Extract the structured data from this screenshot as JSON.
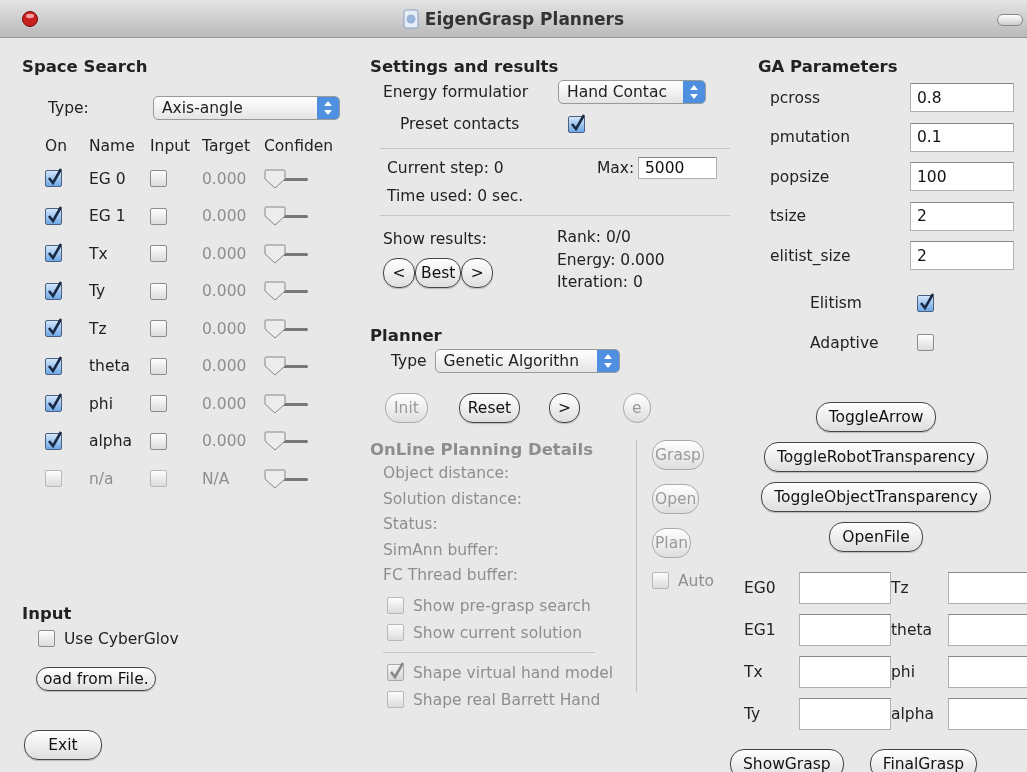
{
  "window": {
    "title": "EigenGrasp Planners"
  },
  "space_search": {
    "title": "Space Search",
    "type_label": "Type:",
    "type_value": "Axis-angle",
    "columns": [
      "On",
      "Name",
      "Input",
      "Target",
      "Confiden"
    ],
    "rows": [
      {
        "on": true,
        "name": "EG 0",
        "input": false,
        "target": "0.000",
        "level": 0,
        "disabled": false
      },
      {
        "on": true,
        "name": "EG 1",
        "input": false,
        "target": "0.000",
        "level": 0,
        "disabled": false
      },
      {
        "on": true,
        "name": "Tx",
        "input": false,
        "target": "0.000",
        "level": 0,
        "disabled": false
      },
      {
        "on": true,
        "name": "Ty",
        "input": false,
        "target": "0.000",
        "level": 0,
        "disabled": false
      },
      {
        "on": true,
        "name": "Tz",
        "input": false,
        "target": "0.000",
        "level": 0,
        "disabled": false
      },
      {
        "on": true,
        "name": "theta",
        "input": false,
        "target": "0.000",
        "level": 0,
        "disabled": false
      },
      {
        "on": true,
        "name": "phi",
        "input": false,
        "target": "0.000",
        "level": 0,
        "disabled": false
      },
      {
        "on": true,
        "name": "alpha",
        "input": false,
        "target": "0.000",
        "level": 0,
        "disabled": false
      },
      {
        "on": false,
        "name": "n/a",
        "input": false,
        "target": "N/A",
        "level": 0,
        "disabled": true
      }
    ]
  },
  "input": {
    "title": "Input",
    "use_cyberglove": {
      "label": "Use CyberGlov",
      "checked": false
    },
    "load_button": "oad from File.",
    "exit_button": "Exit"
  },
  "settings": {
    "title": "Settings and results",
    "energy_label": "Energy formulatior",
    "energy_value": "Hand Contac",
    "preset_label": "Preset contacts",
    "preset_checked": true,
    "current_step": "Current step: 0",
    "max_label": "Max:",
    "max_value": "5000",
    "time_used": "Time used: 0 sec.",
    "show_results": "Show results:",
    "result_buttons": [
      "<",
      "Best",
      ">"
    ],
    "rank": "Rank: 0/0",
    "energy": "Energy: 0.000",
    "iteration": "Iteration: 0"
  },
  "planner": {
    "title": "Planner",
    "type_label": "Type",
    "type_value": "Genetic Algorithn",
    "buttons": [
      {
        "label": "Init",
        "disabled": true
      },
      {
        "label": "Reset",
        "disabled": false
      },
      {
        "label": ">",
        "disabled": false
      },
      {
        "label": "e",
        "disabled": true
      }
    ]
  },
  "online": {
    "title": "OnLine Planning Details",
    "disabled": true,
    "fields": [
      "Object distance:",
      "Solution distance:",
      "Status:",
      "SimAnn buffer:",
      "FC Thread buffer:"
    ],
    "show_checks": [
      {
        "label": "Show pre-grasp search",
        "checked": false
      },
      {
        "label": "Show current solution",
        "checked": false
      }
    ],
    "hand_checks": [
      {
        "label": "Shape virtual hand model",
        "checked": true
      },
      {
        "label": "Shape real Barrett Hand",
        "checked": false
      }
    ],
    "buttons": [
      "Grasp",
      "Open",
      "Plan"
    ],
    "auto": {
      "label": "Auto",
      "checked": false
    }
  },
  "ga": {
    "title": "GA Parameters",
    "params": [
      {
        "label": "pcross",
        "value": "0.8"
      },
      {
        "label": "pmutation",
        "value": "0.1"
      },
      {
        "label": "popsize",
        "value": "100"
      },
      {
        "label": "tsize",
        "value": "2"
      },
      {
        "label": "elitist_size",
        "value": "2"
      }
    ],
    "checks": [
      {
        "label": "Elitism",
        "checked": true
      },
      {
        "label": "Adaptive",
        "checked": false
      }
    ],
    "buttons": [
      "ToggleArrow",
      "ToggleRobotTransparency",
      "ToggleObjectTransparency",
      "OpenFile"
    ],
    "dof_fields": [
      "EG0",
      "Tz",
      "EG1",
      "theta",
      "Tx",
      "phi",
      "Ty",
      "alpha"
    ],
    "bottom_buttons": [
      "ShowGrasp",
      "FinalGrasp"
    ]
  }
}
